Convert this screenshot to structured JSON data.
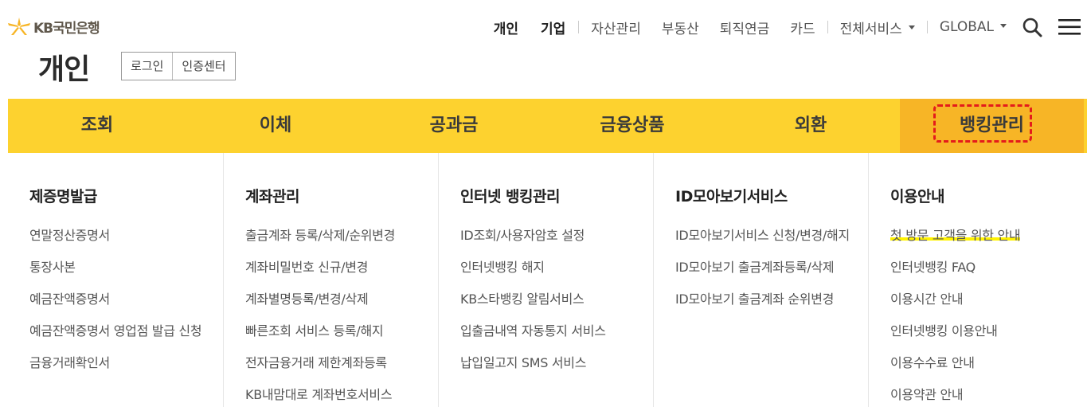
{
  "brand": {
    "name": "KB국민은행",
    "star_color": "#f7b526"
  },
  "topnav": {
    "personal": "개인",
    "business": "기업",
    "items": [
      "자산관리",
      "부동산",
      "퇴직연금",
      "카드"
    ],
    "all_services": "전체서비스",
    "global": "GLOBAL"
  },
  "page": {
    "title": "개인",
    "login": "로그인",
    "cert_center": "인증센터"
  },
  "gnb": {
    "tabs": [
      "조회",
      "이체",
      "공과금",
      "금융상품",
      "외환",
      "뱅킹관리"
    ],
    "active_index": 5,
    "bar_color": "#fdd22f",
    "active_color": "#f7b526",
    "highlight_border_color": "#e41b1b"
  },
  "mega_menu": [
    {
      "title": "제증명발급",
      "items": [
        "연말정산증명서",
        "통장사본",
        "예금잔액증명서",
        "예금잔액증명서 영업점 발급 신청",
        "금융거래확인서"
      ]
    },
    {
      "title": "계좌관리",
      "items": [
        "출금계좌 등록/삭제/순위변경",
        "계좌비밀번호 신규/변경",
        "계좌별명등록/변경/삭제",
        "빠른조회 서비스 등록/해지",
        "전자금융거래 제한계좌등록",
        "KB내맘대로 계좌번호서비스"
      ]
    },
    {
      "title": "인터넷 뱅킹관리",
      "items": [
        "ID조회/사용자암호 설정",
        "인터넷뱅킹 해지",
        "KB스타뱅킹 알림서비스",
        "입출금내역 자동통지 서비스",
        "납입일고지 SMS 서비스"
      ]
    },
    {
      "title": "ID모아보기서비스",
      "items": [
        "ID모아보기서비스 신청/변경/해지",
        "ID모아보기 출금계좌등록/삭제",
        "ID모아보기 출금계좌 순위변경"
      ]
    },
    {
      "title": "이용안내",
      "items": [
        "첫 방문 고객을 위한 안내",
        "인터넷뱅킹 FAQ",
        "이용시간 안내",
        "인터넷뱅킹 이용안내",
        "이용수수료 안내",
        "이용약관 안내"
      ],
      "highlight_color": "#fff200"
    }
  ]
}
